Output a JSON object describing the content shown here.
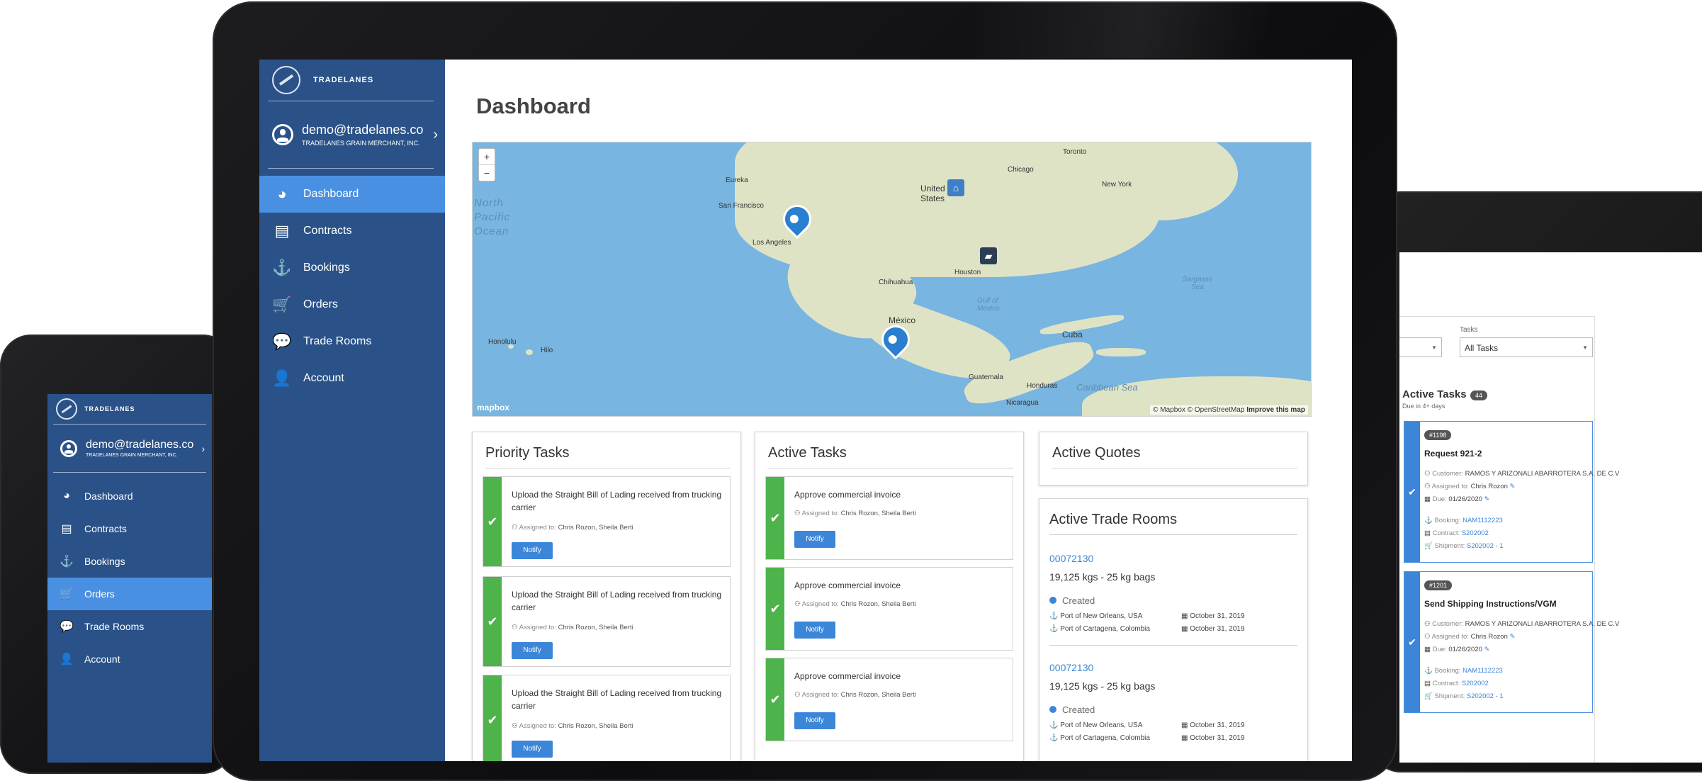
{
  "brand": {
    "name": "TRADELANES"
  },
  "user": {
    "email": "demo@tradelanes.co",
    "company": "TRADELANES GRAIN MERCHANT, INC."
  },
  "nav": [
    {
      "label": "Dashboard",
      "icon": "dashboard-icon"
    },
    {
      "label": "Contracts",
      "icon": "document-icon"
    },
    {
      "label": "Bookings",
      "icon": "anchor-icon"
    },
    {
      "label": "Orders",
      "icon": "cart-icon"
    },
    {
      "label": "Trade Rooms",
      "icon": "chat-icon"
    },
    {
      "label": "Account",
      "icon": "user-icon"
    }
  ],
  "main": {
    "title": "Dashboard",
    "map": {
      "zoom_in": "+",
      "zoom_out": "−",
      "labels": [
        "Eureka",
        "San Francisco",
        "Los Angeles",
        "Chicago",
        "Toronto",
        "New York",
        "United States",
        "Houston",
        "Chihuahua",
        "México",
        "Gulf of Mexico",
        "Cuba",
        "Honduras",
        "Nicaragua",
        "Caribbean Sea",
        "Sargasso Sea",
        "Honolulu",
        "Hilo",
        "Guatemala"
      ],
      "ocean": "North Pacific Ocean",
      "logo": "mapbox",
      "attribution": "© Mapbox © OpenStreetMap",
      "improve": "Improve this map"
    },
    "priority": {
      "title": "Priority Tasks",
      "tasks": [
        {
          "title": "Upload the Straight Bill of Lading received from trucking carrier",
          "assigned_label": "Assigned to:",
          "assigned": "Chris Rozon, Sheila Berti",
          "button": "Notify"
        },
        {
          "title": "Upload the Straight Bill of Lading received from trucking carrier",
          "assigned_label": "Assigned to:",
          "assigned": "Chris Rozon, Sheila Berti",
          "button": "Notify"
        },
        {
          "title": "Upload the Straight Bill of Lading received from trucking carrier",
          "assigned_label": "Assigned to:",
          "assigned": "Chris Rozon, Sheila Berti",
          "button": "Notify"
        }
      ]
    },
    "active": {
      "title": "Active Tasks",
      "tasks": [
        {
          "title": "Approve commercial invoice",
          "assigned_label": "Assigned to:",
          "assigned": "Chris Rozon, Sheila Berti",
          "button": "Notify"
        },
        {
          "title": "Approve commercial invoice",
          "assigned_label": "Assigned to:",
          "assigned": "Chris Rozon, Sheila Berti",
          "button": "Notify"
        },
        {
          "title": "Approve commercial invoice",
          "assigned_label": "Assigned to:",
          "assigned": "Chris Rozon, Sheila Berti",
          "button": "Notify"
        }
      ]
    },
    "quotes": {
      "title": "Active Quotes"
    },
    "trade_rooms": {
      "title": "Active Trade Rooms",
      "rooms": [
        {
          "id": "00072130",
          "desc": "19,125 kgs - 25 kg bags",
          "status": "Created",
          "port_from": "Port of New Orleans, USA",
          "date_from": "October 31, 2019",
          "port_to": "Port of Cartagena, Colombia",
          "date_to": "October 31, 2019"
        },
        {
          "id": "00072130",
          "desc": "19,125 kgs - 25 kg bags",
          "status": "Created",
          "port_from": "Port of New Orleans, USA",
          "date_from": "October 31, 2019",
          "port_to": "Port of Cartagena, Colombia",
          "date_to": "October 31, 2019"
        }
      ]
    }
  },
  "right": {
    "tasks_label": "Tasks",
    "tasks_select": "All Tasks",
    "active_title": "Active Tasks",
    "active_count": "44",
    "due_note": "Due in 4+ days",
    "cards": [
      {
        "num": "#1198",
        "title": "Request 921-2",
        "customer_label": "Customer:",
        "customer": "RAMOS Y ARIZONALI ABARROTERA S.A. DE C.V",
        "assigned_label": "Assigned to:",
        "assigned": "Chris Rozon",
        "due_label": "Due:",
        "due": "01/26/2020",
        "booking_label": "Booking:",
        "booking": "NAM1112223",
        "contract_label": "Contract:",
        "contract": "S202002",
        "shipment_label": "Shipment:",
        "shipment": "S202002 - 1"
      },
      {
        "num": "#1201",
        "title": "Send Shipping Instructions/VGM",
        "customer_label": "Customer:",
        "customer": "RAMOS Y ARIZONALI ABARROTERA S.A. DE C.V",
        "assigned_label": "Assigned to:",
        "assigned": "Chris Rozon",
        "due_label": "Due:",
        "due": "01/26/2020",
        "booking_label": "Booking:",
        "booking": "NAM1112223",
        "contract_label": "Contract:",
        "contract": "S202002",
        "shipment_label": "Shipment:",
        "shipment": "S202002 - 1"
      }
    ]
  },
  "colors": {
    "sidebar": "#2a5289",
    "active_nav": "#4a90e2",
    "task_bar": "#4db34a",
    "link": "#3b86d8",
    "map_water": "#78b5e0",
    "map_land": "#dfe3c6"
  }
}
